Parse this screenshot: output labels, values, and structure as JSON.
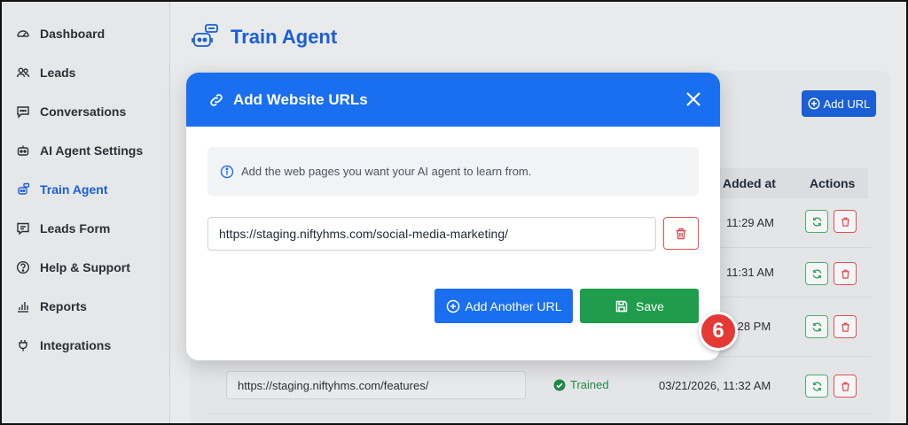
{
  "sidebar": {
    "items": [
      {
        "label": "Dashboard",
        "icon": "gauge-icon"
      },
      {
        "label": "Leads",
        "icon": "users-icon"
      },
      {
        "label": "Conversations",
        "icon": "chat-icon"
      },
      {
        "label": "AI Agent Settings",
        "icon": "robot-icon"
      },
      {
        "label": "Train Agent",
        "icon": "train-agent-icon",
        "active": true
      },
      {
        "label": "Leads Form",
        "icon": "form-chat-icon"
      },
      {
        "label": "Help & Support",
        "icon": "question-icon"
      },
      {
        "label": "Reports",
        "icon": "bar-chart-icon"
      },
      {
        "label": "Integrations",
        "icon": "plug-icon"
      }
    ]
  },
  "header": {
    "title": "Train Agent"
  },
  "background": {
    "add_url_label": "Add URL",
    "columns": {
      "added_at": "Added at",
      "actions": "Actions"
    },
    "rows": [
      {
        "time": "11:29 AM"
      },
      {
        "time": "11:31 AM"
      },
      {
        "time": ":28 PM"
      },
      {
        "url": "https://staging.niftyhms.com/features/",
        "status": "Trained",
        "time": "03/21/2026, 11:32 AM"
      }
    ]
  },
  "modal": {
    "title": "Add Website URLs",
    "info": "Add the web pages you want your AI agent to learn from.",
    "url_value": "https://staging.niftyhms.com/social-media-marketing/",
    "add_another_label": "Add Another URL",
    "save_label": "Save"
  },
  "step_badge": "6",
  "colors": {
    "primary": "#1a6ff0",
    "success": "#1f9d4c",
    "danger": "#e05252",
    "badge": "#e53935"
  }
}
